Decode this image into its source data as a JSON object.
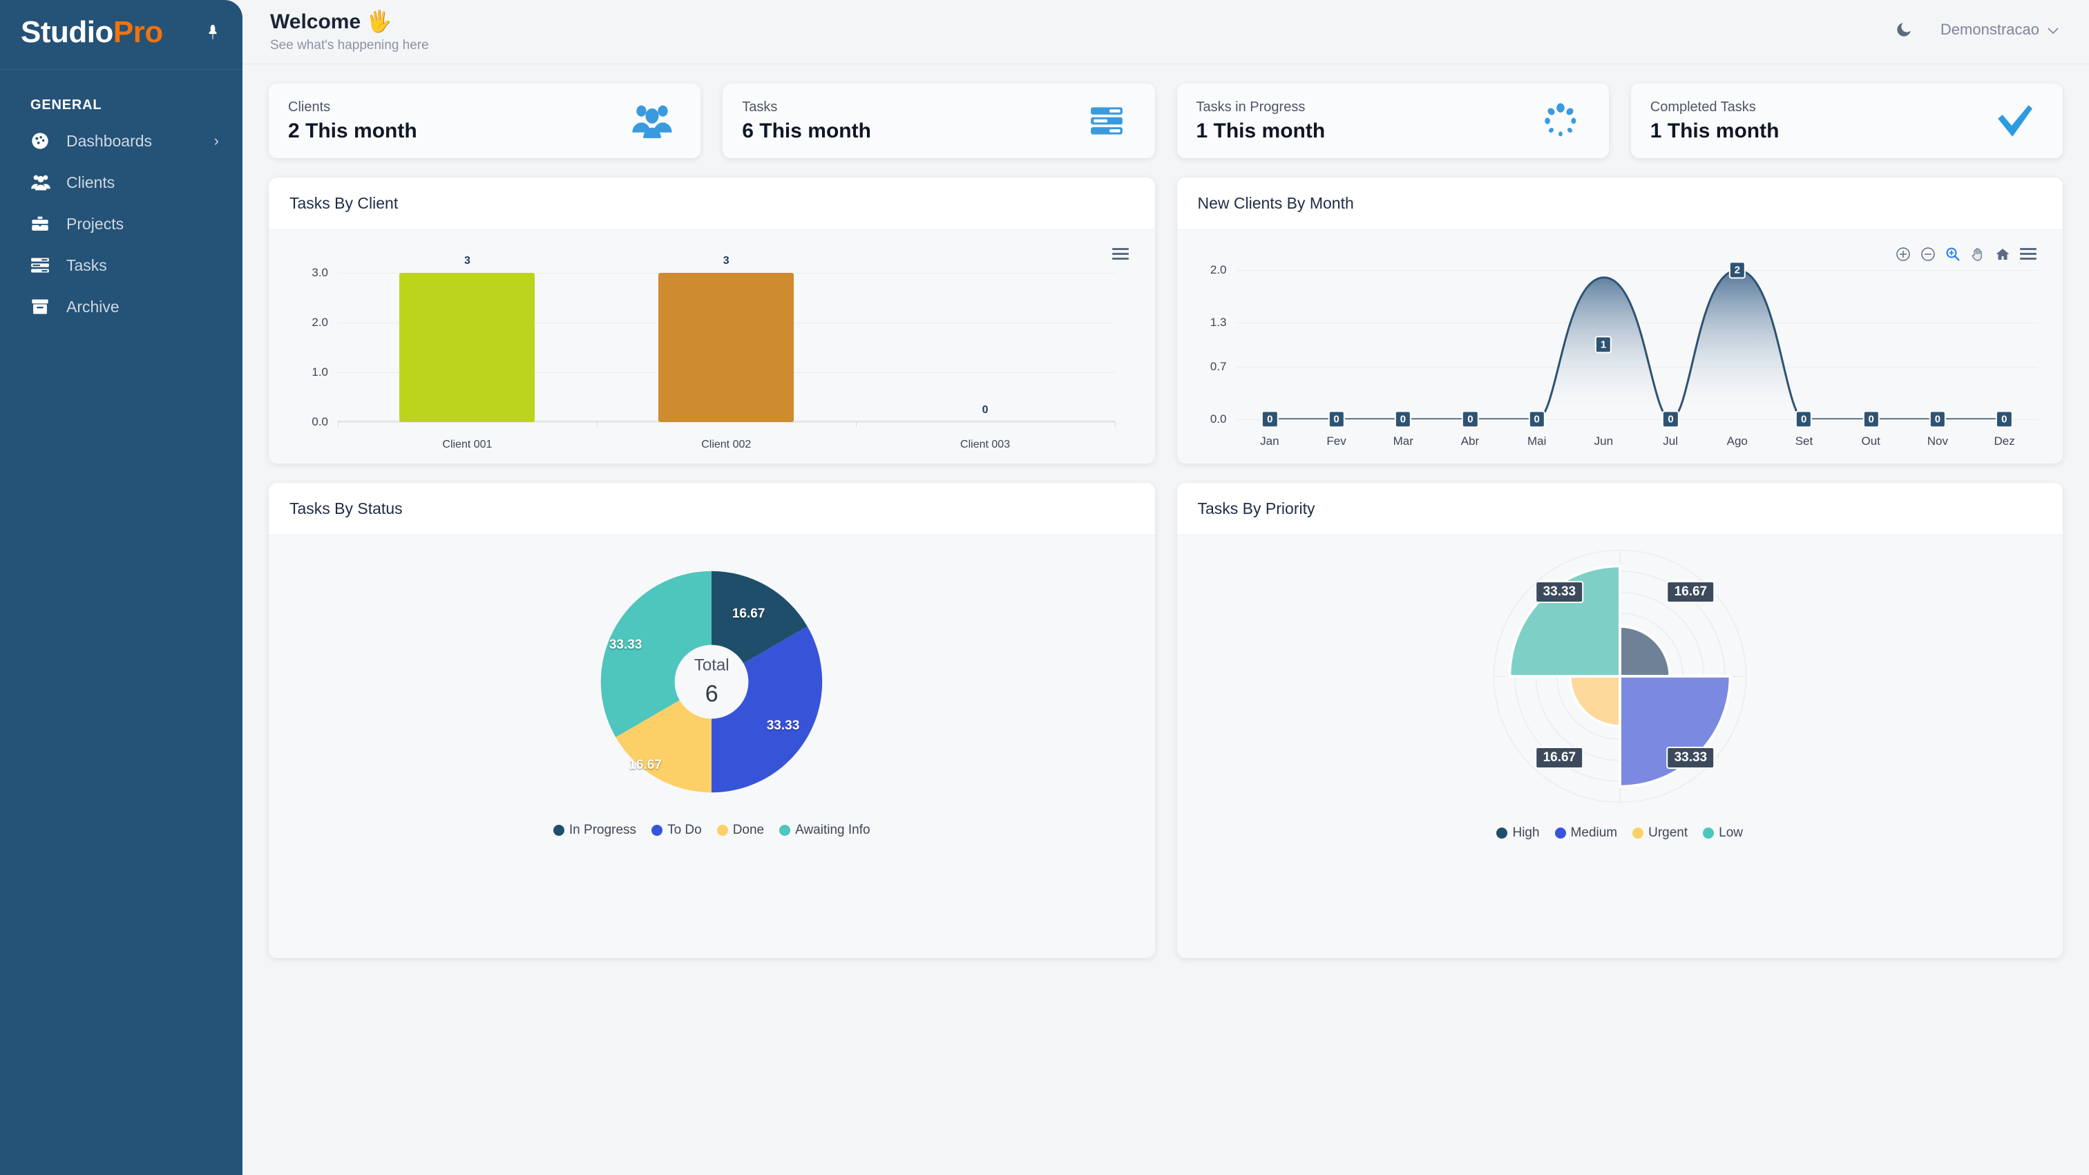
{
  "sidebar": {
    "brand_part1": "Studio",
    "brand_part2": "Pro",
    "pin_icon": "pin-icon",
    "section_label": "GENERAL",
    "items": [
      {
        "label": "Dashboards",
        "icon": "dashboard-gauge-icon",
        "has_chevron": true
      },
      {
        "label": "Clients",
        "icon": "people-group-icon",
        "has_chevron": false
      },
      {
        "label": "Projects",
        "icon": "briefcase-icon",
        "has_chevron": false
      },
      {
        "label": "Tasks",
        "icon": "task-list-icon",
        "has_chevron": false
      },
      {
        "label": "Archive",
        "icon": "archive-box-icon",
        "has_chevron": false
      }
    ]
  },
  "header": {
    "title": "Welcome",
    "title_emoji": "🖐",
    "subtitle": "See what's happening here",
    "dark_mode_icon": "moon-icon",
    "user_name": "Demonstracao",
    "user_chevron_icon": "chevron-down-icon"
  },
  "kpis": [
    {
      "label": "Clients",
      "value": "2 This month",
      "icon": "people-group-icon"
    },
    {
      "label": "Tasks",
      "value": "6 This month",
      "icon": "task-list-icon"
    },
    {
      "label": "Tasks in Progress",
      "value": "1 This month",
      "icon": "spinner-icon"
    },
    {
      "label": "Completed Tasks",
      "value": "1 This month",
      "icon": "check-mark-icon"
    }
  ],
  "panels": {
    "tasks_by_client": "Tasks By Client",
    "new_clients_by_month": "New Clients By Month",
    "tasks_by_status": "Tasks By Status",
    "tasks_by_priority": "Tasks By Priority"
  },
  "toolbar": {
    "menu_icon": "hamburger-menu-icon",
    "zoom_in_icon": "zoom-in-icon",
    "zoom_out_icon": "zoom-out-icon",
    "selection_zoom_icon": "selection-zoom-icon",
    "pan_icon": "pan-hand-icon",
    "reset_icon": "home-reset-icon"
  },
  "colors": {
    "sidebar_bg": "#255277",
    "brand_orange": "#f0730f",
    "kpi_icon_blue": "#3a9ade",
    "bar_client_001": "#bcd41b",
    "bar_client_002": "#ce8b2f",
    "line_stroke": "#2e5372",
    "status_in_progress": "#1f4e6b",
    "status_to_do": "#3754d9",
    "status_done": "#fcd066",
    "status_awaiting_info": "#4ec5bd",
    "priority_high": "#6f8196",
    "priority_medium": "#7b8ae0",
    "priority_urgent": "#fcd99b",
    "priority_low": "#7ed0c6"
  },
  "chart_data": [
    {
      "type": "bar",
      "title": "Tasks By Client",
      "categories": [
        "Client 001",
        "Client 002",
        "Client 003"
      ],
      "values": [
        3,
        3,
        0
      ],
      "data_labels": [
        "3",
        "3",
        "0"
      ],
      "colors": [
        "#bcd41b",
        "#ce8b2f",
        "#bcd41b"
      ],
      "ylim": [
        0,
        3
      ],
      "yticks": [
        "0.0",
        "1.0",
        "2.0",
        "3.0"
      ],
      "ytick_values": [
        0,
        1,
        2,
        3
      ],
      "xlabel": "",
      "ylabel": "",
      "grid": true,
      "legend": "none"
    },
    {
      "type": "area",
      "title": "New Clients By Month",
      "categories": [
        "Jan",
        "Fev",
        "Mar",
        "Abr",
        "Mai",
        "Jun",
        "Jul",
        "Ago",
        "Set",
        "Out",
        "Nov",
        "Dez"
      ],
      "values": [
        0,
        0,
        0,
        0,
        0,
        1,
        0,
        2,
        0,
        0,
        0,
        0
      ],
      "data_labels": [
        "0",
        "0",
        "0",
        "0",
        "0",
        "1",
        "0",
        "2",
        "0",
        "0",
        "0",
        "0"
      ],
      "ylim": [
        0,
        2
      ],
      "yticks": [
        "0.0",
        "0.7",
        "1.3",
        "2.0"
      ],
      "ytick_values": [
        0,
        0.7,
        1.3,
        2
      ],
      "xlabel": "",
      "ylabel": "",
      "grid": true,
      "legend": "none",
      "stroke_color": "#2e5372",
      "curve": "smooth"
    },
    {
      "type": "pie",
      "title": "Tasks By Status",
      "subtitle": "donut",
      "center_label": "Total",
      "center_value": "6",
      "labels": [
        "In Progress",
        "To Do",
        "Done",
        "Awaiting Info"
      ],
      "values": [
        16.67,
        33.33,
        16.67,
        33.33
      ],
      "data_labels": [
        "16.67",
        "33.33",
        "16.67",
        "33.33"
      ],
      "counts": [
        1,
        2,
        1,
        2
      ],
      "colors": [
        "#1f4e6b",
        "#3754d9",
        "#fcd066",
        "#4ec5bd"
      ],
      "legend": "bottom"
    },
    {
      "type": "pie",
      "title": "Tasks By Priority",
      "subtitle": "polar-area",
      "labels": [
        "High",
        "Medium",
        "Urgent",
        "Low"
      ],
      "values": [
        16.67,
        33.33,
        16.67,
        33.33
      ],
      "data_labels": [
        "16.67",
        "33.33",
        "16.67",
        "33.33"
      ],
      "counts": [
        1,
        2,
        1,
        2
      ],
      "colors": [
        "#6f8196",
        "#7b8ae0",
        "#fcd99b",
        "#7ed0c6"
      ],
      "legend": "bottom"
    }
  ]
}
